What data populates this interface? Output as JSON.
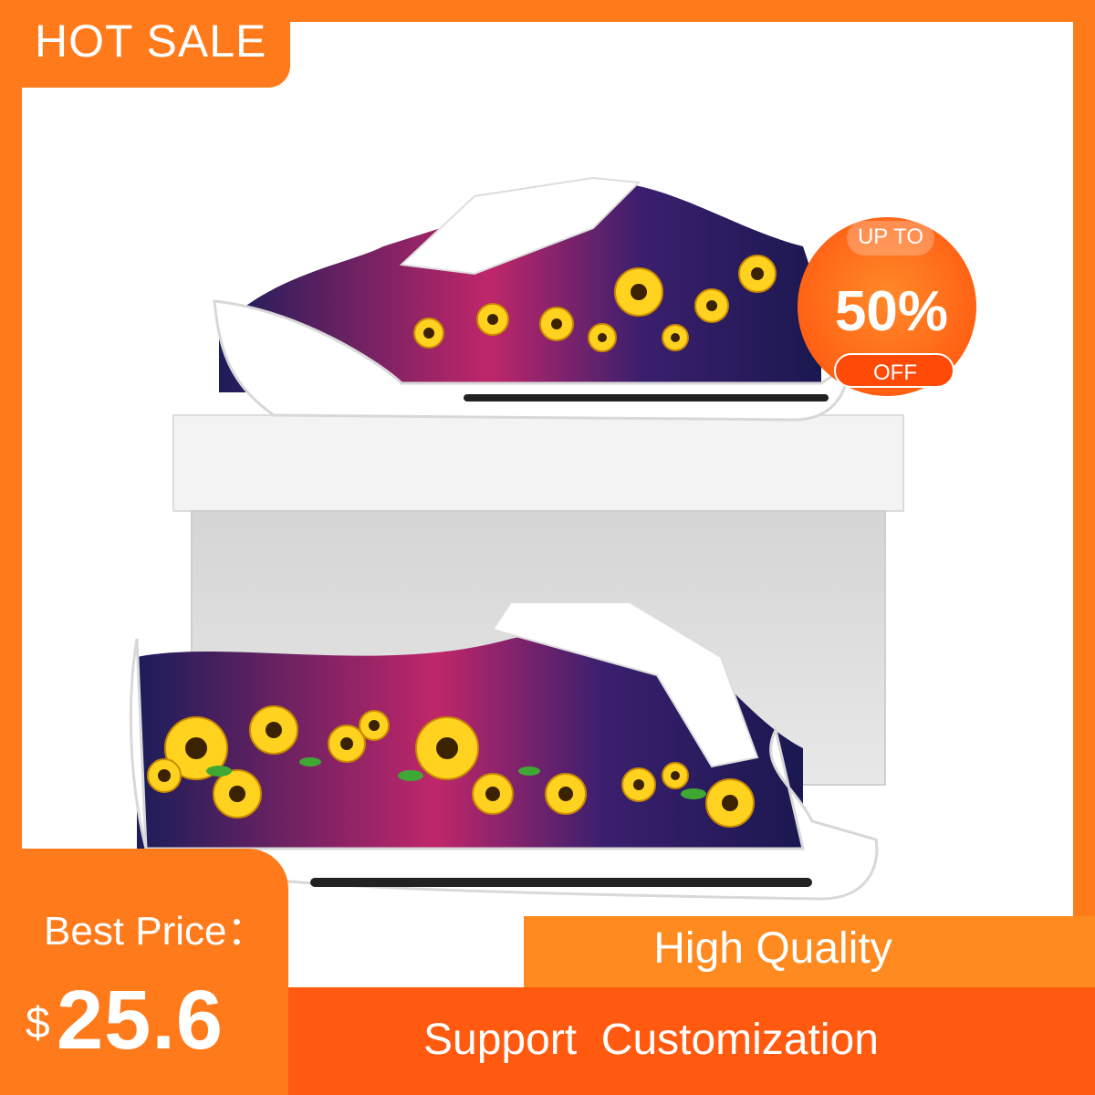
{
  "banner": {
    "hot_sale": "HOT SALE"
  },
  "discount": {
    "up_to": "UP TO",
    "percent": "50%",
    "off": "OFF"
  },
  "price": {
    "label": "Best Price：",
    "currency": "$",
    "value": "25.6"
  },
  "features": {
    "quality": "High Quality",
    "customization": "Support  Customization"
  },
  "product": {
    "icon": "sunflower-sneaker-image"
  },
  "colors": {
    "accent": "#ff7a1a",
    "accent_dark": "#ff5a0f",
    "badge": "#ff6a1a",
    "box": "#dedede"
  }
}
